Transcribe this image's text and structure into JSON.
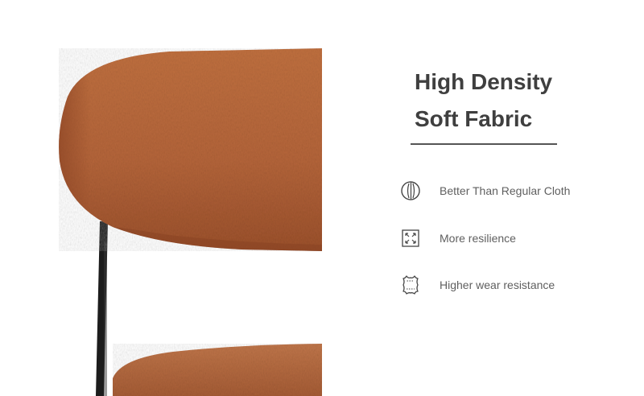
{
  "headline": {
    "line1": "High Density",
    "line2": "Soft Fabric"
  },
  "features": [
    {
      "icon": "fabric-layers-icon",
      "label": "Better Than Regular Cloth"
    },
    {
      "icon": "expand-arrows-icon",
      "label": "More resilience"
    },
    {
      "icon": "leather-hide-icon",
      "label": "Higher wear resistance"
    }
  ],
  "colors": {
    "fabric": "#b8673d",
    "fabric_dark": "#8f4726",
    "frame": "#1c1c1c",
    "text_heading": "#3f3f3f",
    "text_body": "#5f5f5f",
    "rule": "#555555"
  }
}
